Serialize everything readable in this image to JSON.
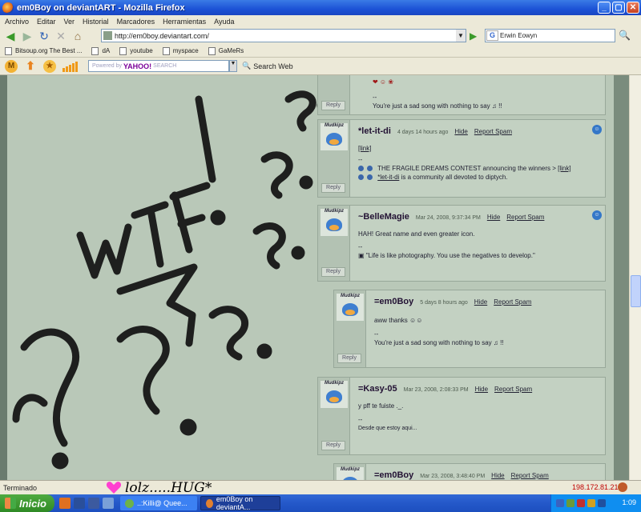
{
  "window": {
    "title": "em0Boy on deviantART - Mozilla Firefox"
  },
  "menu": [
    "Archivo",
    "Editar",
    "Ver",
    "Historial",
    "Marcadores",
    "Herramientas",
    "Ayuda"
  ],
  "nav": {
    "url": "http://em0boy.deviantart.com/",
    "search_value": "Erwin Eowyn"
  },
  "bookmarks": [
    "Bitsoup.org The Best ...",
    "dA",
    "youtube",
    "myspace",
    "GaMeRs"
  ],
  "yahoo": {
    "placeholder_prefix": "Powered by",
    "brand": "YAHOO!",
    "search_word": "SEARCH",
    "search_web": "Search Web"
  },
  "comments": [
    {
      "smiley_line": "❤ ☺ ❀",
      "sig_dash": "--",
      "text": "You're just a sad song with nothing to say ♫ !!",
      "reply": "Reply"
    },
    {
      "username": "*let-it-di",
      "date": "4 days 14 hours ago",
      "hide": "Hide",
      "report": "Report Spam",
      "link_text": "[link]",
      "sig_dash": "--",
      "line1_prefix": "THE FRAGILE DREAMS CONTEST announcing the winners > ",
      "line1_link": "[link]",
      "line2_user": "*let-it-di",
      "line2_rest": " is a community all devoted to diptych.",
      "reply": "Reply"
    },
    {
      "username": "~BelleMagie",
      "date": "Mar 24, 2008, 9:37:34 PM",
      "hide": "Hide",
      "report": "Report Spam",
      "text": "HAH! Great name and even greater icon.",
      "sig_dash": "--",
      "sig": "\"Life is like photography. You use the negatives to develop.\"",
      "reply": "Reply"
    },
    {
      "username": "=em0Boy",
      "date": "5 days 8 hours ago",
      "hide": "Hide",
      "report": "Report Spam",
      "text": "aww thanks ☺☺",
      "sig_dash": "--",
      "sig": "You're just a sad song with nothing to say ♫ !!",
      "reply": "Reply"
    },
    {
      "username": "=Kasy-05",
      "date": "Mar 23, 2008, 2:08:33 PM",
      "hide": "Hide",
      "report": "Report Spam",
      "text": "y pff te fuiste ._.",
      "sig_dash": "--",
      "sig": "Desde que estoy aqui...",
      "reply": "Reply"
    },
    {
      "username": "=em0Boy",
      "date": "Mar 23, 2008, 3:48:40 PM",
      "hide": "Hide",
      "report": "Report Spam"
    }
  ],
  "avatar_label": "Mudkipz",
  "scribble_text": "WTF!",
  "status": {
    "text": "Terminado",
    "overlay": "lolz.....HUG*",
    "ip": "198.172.81.21"
  },
  "taskbar": {
    "start": "Inicio",
    "task1": "..:Killi@ Quee...",
    "task2": "em0Boy on deviantA...",
    "clock": "1:09"
  }
}
